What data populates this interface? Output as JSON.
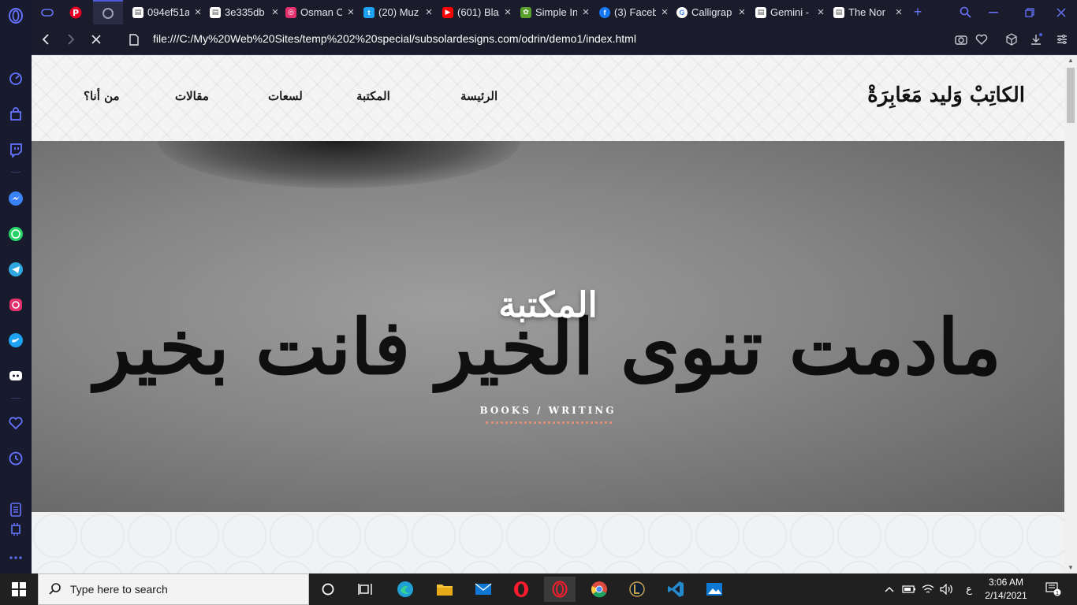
{
  "browser": {
    "tabs": [
      {
        "title": "094ef51a",
        "favicon": "doc"
      },
      {
        "title": "3e335db",
        "favicon": "doc"
      },
      {
        "title": "Osman C",
        "favicon": "instagram"
      },
      {
        "title": "(20) Muz",
        "favicon": "twitter"
      },
      {
        "title": "(601) Bla",
        "favicon": "youtube"
      },
      {
        "title": "Simple In",
        "favicon": "leaf"
      },
      {
        "title": "(3) Faceb",
        "favicon": "facebook"
      },
      {
        "title": "Calligrap",
        "favicon": "google"
      },
      {
        "title": "Gemini -",
        "favicon": "doc"
      },
      {
        "title": "The Nor",
        "favicon": "doc"
      }
    ],
    "new_tab_label": "+",
    "url": "file:///C:/My%20Web%20Sites/temp%202%20special/subsolardesigns.com/odrin/demo1/index.html"
  },
  "site": {
    "logo": "الكاتِبْ وَليد مَعَابِرَةْ",
    "nav": {
      "home": "الرئيسة",
      "library": "المكتبة",
      "songs": "لسعات",
      "articles": "مقالات",
      "about": "من أنا؟"
    },
    "hero": {
      "title": "المكتبة",
      "subtitle": "BOOKS / WRITING",
      "calligraphy": "مادمت تنوى الخير فانت بخير"
    }
  },
  "taskbar": {
    "search_placeholder": "Type here to search",
    "time": "3:06 AM",
    "date": "2/14/2021",
    "lang": "ع",
    "notifications": "1"
  },
  "colors": {
    "accent": "#4f5bd5",
    "underline": "#e0907a",
    "sidebar": "#181a2d"
  }
}
